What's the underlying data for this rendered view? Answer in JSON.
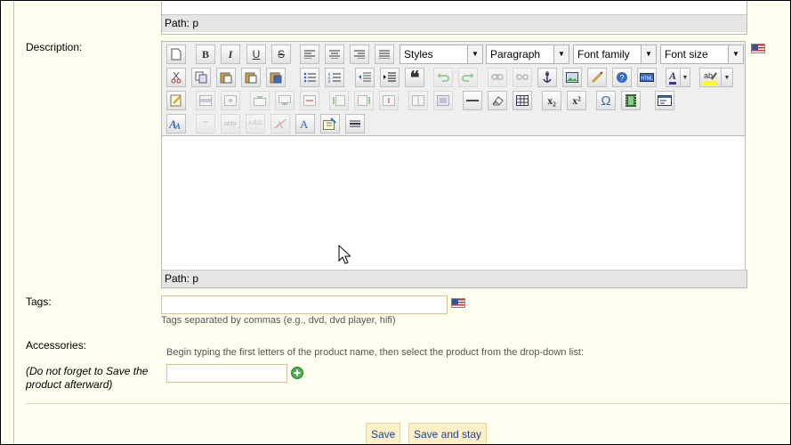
{
  "top_editor": {
    "path_label": "Path: p"
  },
  "description": {
    "label": "Description:",
    "styles": "Styles",
    "paragraph": "Paragraph",
    "font_family": "Font family",
    "font_size": "Font size",
    "path_label": "Path: p"
  },
  "icons": {
    "bold": "B",
    "italic": "I",
    "underline": "U",
    "strike": "S",
    "quote": "❝",
    "subscript": "x₂",
    "superscript": "x²",
    "omega": "Ω",
    "font_a": "A"
  },
  "tags": {
    "label": "Tags:",
    "value": "",
    "hint": "Tags separated by commas (e.g., dvd, dvd player, hifi)"
  },
  "accessories": {
    "label": "Accessories:",
    "note": "(Do not forget to Save the product afterward)",
    "instruction": "Begin typing the first letters of the product name, then select the product from the drop-down list:",
    "value": ""
  },
  "actions": {
    "save": "Save",
    "save_and_stay": "Save and stay"
  },
  "colors": {
    "background": "#fffff0",
    "button_text": "#1f3f9a",
    "button_bg": "#fdf0c8"
  }
}
